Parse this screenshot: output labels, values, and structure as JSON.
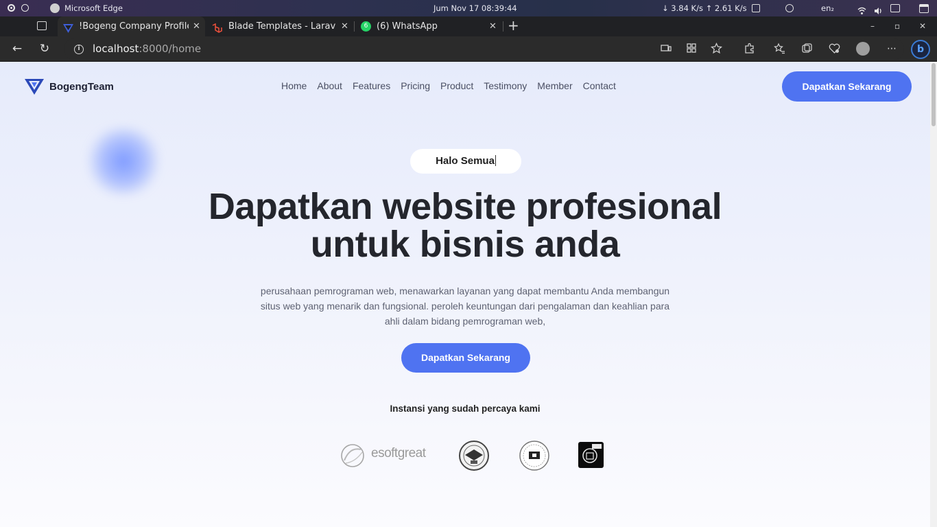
{
  "os": {
    "app_name": "Microsoft Edge",
    "clock": "Jum Nov 17  08:39:44",
    "network": "↓ 3.84 K/s ↑ 2.61 K/s",
    "lang": "en₂"
  },
  "tabs": [
    {
      "label": "!Bogeng Company Profile",
      "icon": "bogeng-logo-icon",
      "active": true
    },
    {
      "label": "Blade Templates - Laravel",
      "icon": "laravel-icon",
      "active": false
    },
    {
      "label": "(6) WhatsApp",
      "icon": "whatsapp-icon",
      "active": false,
      "badge": "6"
    }
  ],
  "address": {
    "host": "localhost",
    "path": ":8000/home"
  },
  "site": {
    "brand": "BogengTeam",
    "nav": [
      "Home",
      "About",
      "Features",
      "Pricing",
      "Product",
      "Testimony",
      "Member",
      "Contact"
    ],
    "cta_top": "Dapatkan Sekarang",
    "greeting": "Halo Semua",
    "hero_line1": "Dapatkan website profesional",
    "hero_line2": "untuk bisnis anda",
    "description": "perusahaan pemrograman web, menawarkan layanan yang dapat membantu Anda membangun situs web yang menarik dan fungsional. peroleh keuntungan dari pengalaman dan keahlian para ahli dalam bidang pemrograman web,",
    "cta_hero": "Dapatkan Sekarang",
    "trust_title": "Instansi yang sudah percaya kami",
    "partner_logo_text": "esoftgreat"
  },
  "colors": {
    "accent": "#4f73f1",
    "heading": "#24262d"
  }
}
